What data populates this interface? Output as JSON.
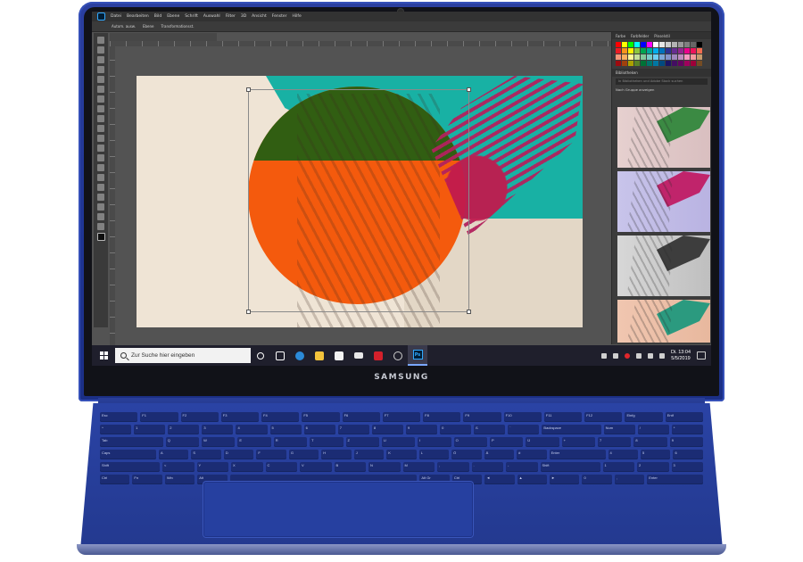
{
  "device": {
    "brand": "SAMSUNG"
  },
  "photoshop": {
    "menu": [
      "Datei",
      "Bearbeiten",
      "Bild",
      "Ebene",
      "Schrift",
      "Auswahl",
      "Filter",
      "3D",
      "Ansicht",
      "Fenster",
      "Hilfe"
    ],
    "options": [
      "Autom. ausw.",
      "Ebene",
      "Transformationsst."
    ],
    "panel_tabs": [
      "Farbe",
      "Farbfelder",
      "Pinselstil"
    ],
    "libraries_title": "Bibliotheken",
    "libraries_search": "In Bibliotheken und Adobe Stock suchen",
    "libraries_group": "Nach Gruppe anzeigen"
  },
  "taskbar": {
    "search_placeholder": "Zur Suche hier eingeben",
    "clock_time": "Di. 13:04",
    "clock_date": "5/5/2019"
  },
  "keyboard_rows": [
    [
      "Esc",
      "F1",
      "F2",
      "F3",
      "F4",
      "F5",
      "F6",
      "F7",
      "F8",
      "F9",
      "F10",
      "F11",
      "F12",
      "Einfg",
      "Entf"
    ],
    [
      "^",
      "1",
      "2",
      "3",
      "4",
      "5",
      "6",
      "7",
      "8",
      "9",
      "0",
      "ß",
      "´",
      "Backspace",
      "Num",
      "/",
      "*"
    ],
    [
      "Tab",
      "Q",
      "W",
      "E",
      "R",
      "T",
      "Z",
      "U",
      "I",
      "O",
      "P",
      "Ü",
      "+",
      "7",
      "8",
      "9"
    ],
    [
      "Caps",
      "A",
      "S",
      "D",
      "F",
      "G",
      "H",
      "J",
      "K",
      "L",
      "Ö",
      "Ä",
      "#",
      "Enter",
      "4",
      "5",
      "6"
    ],
    [
      "Shift",
      "<",
      "Y",
      "X",
      "C",
      "V",
      "B",
      "N",
      "M",
      ",",
      ".",
      "-",
      "Shift",
      "1",
      "2",
      "3"
    ],
    [
      "Ctrl",
      "Fn",
      "Win",
      "Alt",
      "",
      "Alt Gr",
      "Ctrl",
      "◄",
      "▲",
      "►",
      "0",
      ",",
      "Enter"
    ]
  ],
  "colors": {
    "chassis": "#23398f",
    "accent_orange": "#f45a0d",
    "accent_teal": "#18b1a4"
  }
}
